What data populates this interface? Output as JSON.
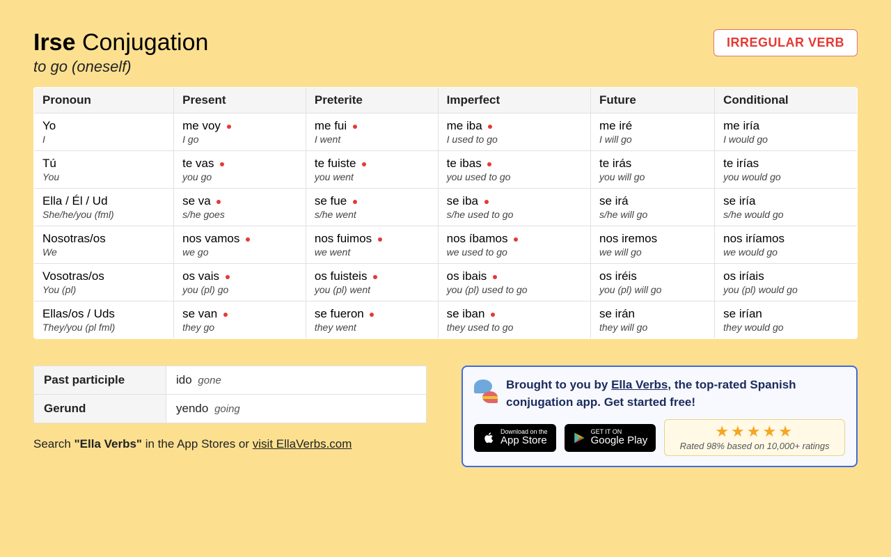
{
  "header": {
    "verb": "Irse",
    "title_suffix": "Conjugation",
    "subtitle": "to go (oneself)",
    "badge": "IRREGULAR VERB"
  },
  "columns": [
    "Pronoun",
    "Present",
    "Preterite",
    "Imperfect",
    "Future",
    "Conditional"
  ],
  "rows": [
    {
      "pronoun": {
        "es": "Yo",
        "en": "I"
      },
      "present": {
        "es": "me voy",
        "en": "I go",
        "irr": true
      },
      "preterite": {
        "es": "me fui",
        "en": "I went",
        "irr": true
      },
      "imperfect": {
        "es": "me iba",
        "en": "I used to go",
        "irr": true
      },
      "future": {
        "es": "me iré",
        "en": "I will go",
        "irr": false
      },
      "conditional": {
        "es": "me iría",
        "en": "I would go",
        "irr": false
      }
    },
    {
      "pronoun": {
        "es": "Tú",
        "en": "You"
      },
      "present": {
        "es": "te vas",
        "en": "you go",
        "irr": true
      },
      "preterite": {
        "es": "te fuiste",
        "en": "you went",
        "irr": true
      },
      "imperfect": {
        "es": "te ibas",
        "en": "you used to go",
        "irr": true
      },
      "future": {
        "es": "te irás",
        "en": "you will go",
        "irr": false
      },
      "conditional": {
        "es": "te irías",
        "en": "you would go",
        "irr": false
      }
    },
    {
      "pronoun": {
        "es": "Ella / Él / Ud",
        "en": "She/he/you (fml)"
      },
      "present": {
        "es": "se va",
        "en": "s/he goes",
        "irr": true
      },
      "preterite": {
        "es": "se fue",
        "en": "s/he went",
        "irr": true
      },
      "imperfect": {
        "es": "se iba",
        "en": "s/he used to go",
        "irr": true
      },
      "future": {
        "es": "se irá",
        "en": "s/he will go",
        "irr": false
      },
      "conditional": {
        "es": "se iría",
        "en": "s/he would go",
        "irr": false
      }
    },
    {
      "pronoun": {
        "es": "Nosotras/os",
        "en": "We"
      },
      "present": {
        "es": "nos vamos",
        "en": "we go",
        "irr": true
      },
      "preterite": {
        "es": "nos fuimos",
        "en": "we went",
        "irr": true
      },
      "imperfect": {
        "es": "nos íbamos",
        "en": "we used to go",
        "irr": true
      },
      "future": {
        "es": "nos iremos",
        "en": "we will go",
        "irr": false
      },
      "conditional": {
        "es": "nos iríamos",
        "en": "we would go",
        "irr": false
      }
    },
    {
      "pronoun": {
        "es": "Vosotras/os",
        "en": "You (pl)"
      },
      "present": {
        "es": "os vais",
        "en": "you (pl) go",
        "irr": true
      },
      "preterite": {
        "es": "os fuisteis",
        "en": "you (pl) went",
        "irr": true
      },
      "imperfect": {
        "es": "os ibais",
        "en": "you (pl) used to go",
        "irr": true
      },
      "future": {
        "es": "os iréis",
        "en": "you (pl) will go",
        "irr": false
      },
      "conditional": {
        "es": "os iríais",
        "en": "you (pl) would go",
        "irr": false
      }
    },
    {
      "pronoun": {
        "es": "Ellas/os / Uds",
        "en": "They/you (pl fml)"
      },
      "present": {
        "es": "se van",
        "en": "they go",
        "irr": true
      },
      "preterite": {
        "es": "se fueron",
        "en": "they went",
        "irr": true
      },
      "imperfect": {
        "es": "se iban",
        "en": "they used to go",
        "irr": true
      },
      "future": {
        "es": "se irán",
        "en": "they will go",
        "irr": false
      },
      "conditional": {
        "es": "se irían",
        "en": "they would go",
        "irr": false
      }
    }
  ],
  "forms": {
    "past_participle_label": "Past participle",
    "past_participle_es": "ido",
    "past_participle_en": "gone",
    "gerund_label": "Gerund",
    "gerund_es": "yendo",
    "gerund_en": "going"
  },
  "search_line": {
    "prefix": "Search ",
    "quoted": "\"Ella Verbs\"",
    "middle": " in the App Stores or ",
    "link_text": "visit EllaVerbs.com"
  },
  "promo": {
    "line1_prefix": "Brought to you by ",
    "line1_link": "Ella Verbs",
    "line1_suffix": ", the top-rated Spanish conjugation app. Get started free!",
    "appstore_small": "Download on the",
    "appstore_big": "App Store",
    "play_small": "GET IT ON",
    "play_big": "Google Play",
    "stars": "★★★★★",
    "rating_text": "Rated 98% based on 10,000+ ratings"
  }
}
